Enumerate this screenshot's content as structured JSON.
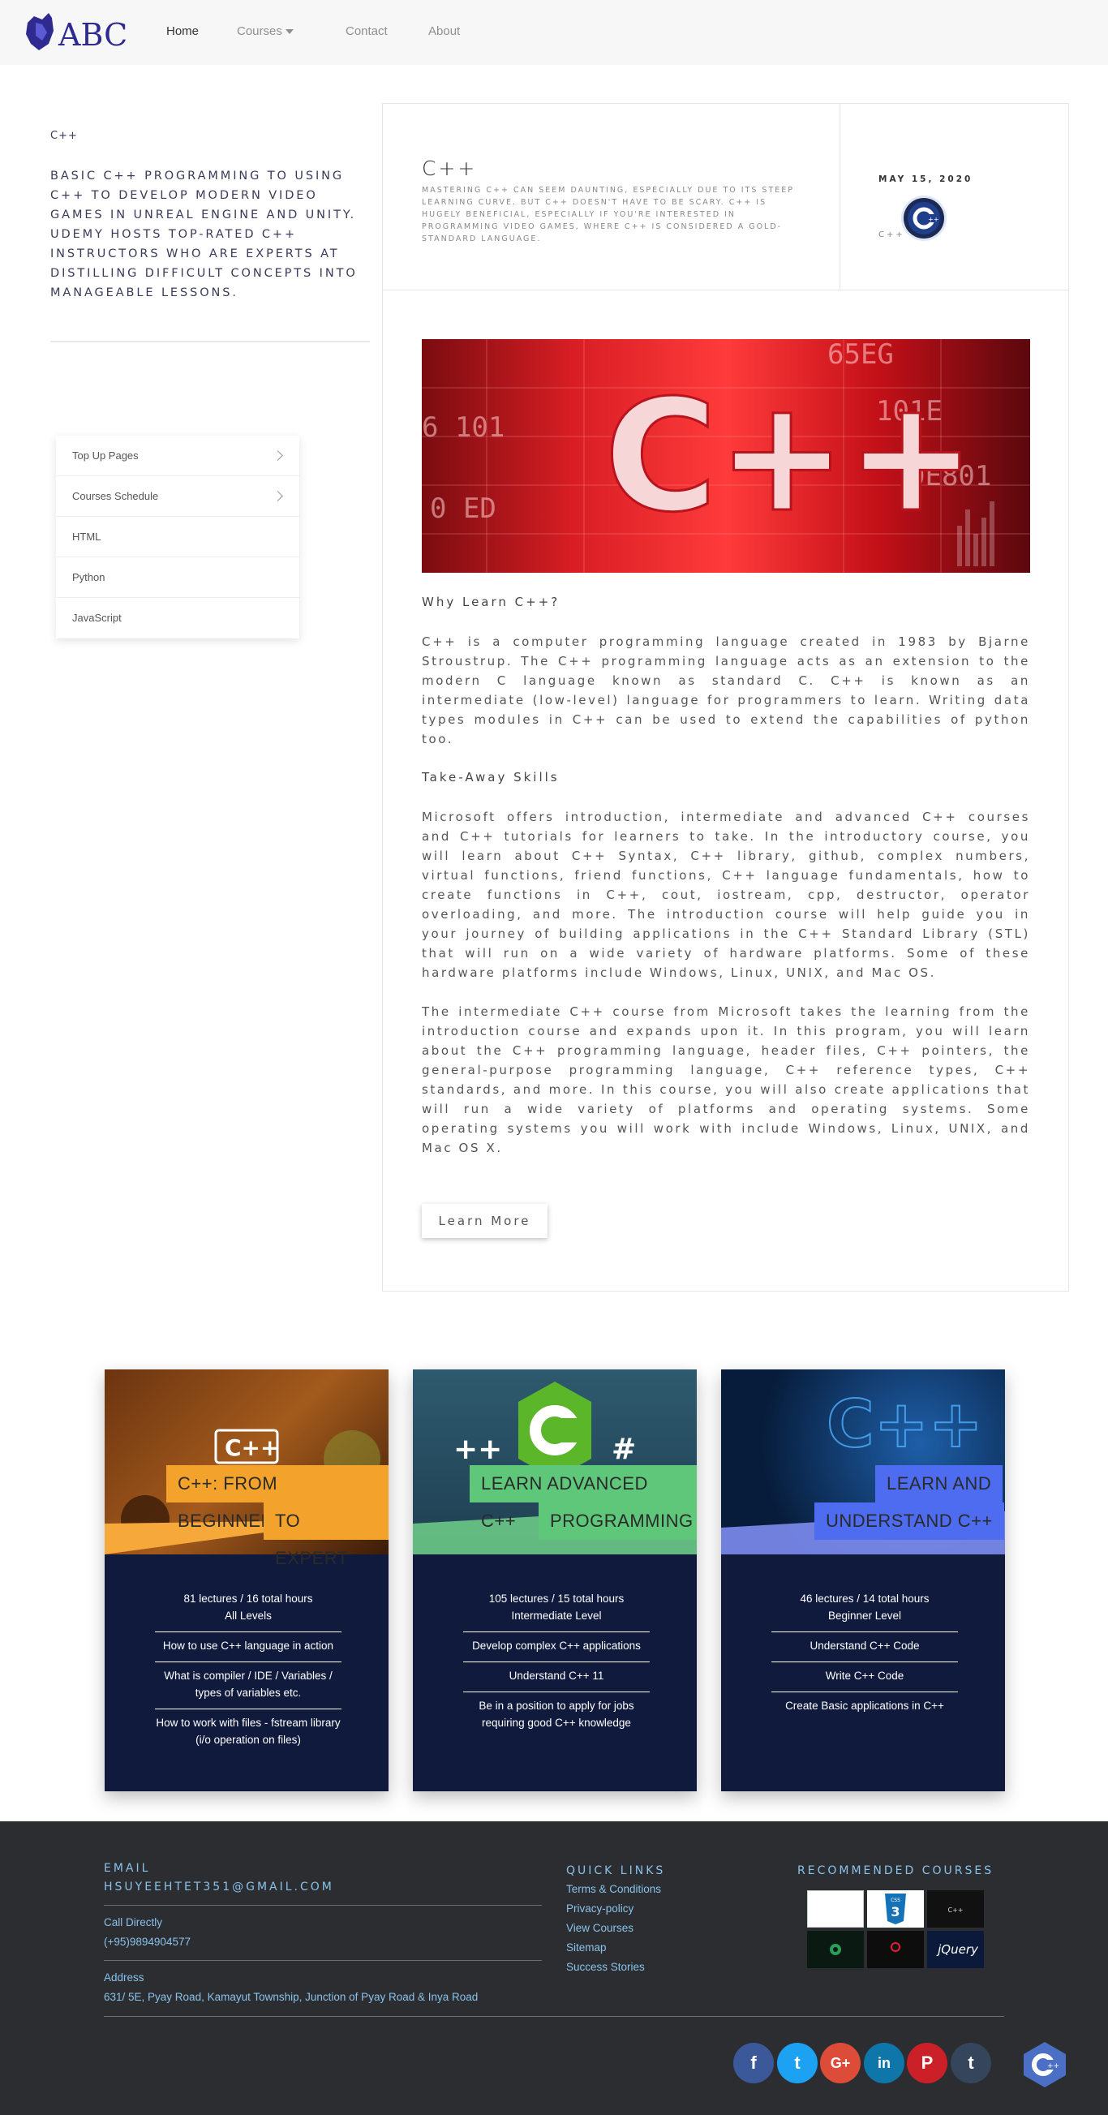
{
  "nav": {
    "brand": "ABC",
    "home": "Home",
    "courses": "Courses",
    "contact": "Contact",
    "about": "About"
  },
  "sidebar": {
    "title": "C++",
    "description": "Basic C++ programming to using C++ to develop modern video games in Unreal Engine and Unity. Udemy hosts top-rated C++ instructors who are experts at distilling difficult concepts into manageable lessons.",
    "menu": [
      "Top Up Pages",
      "Courses Schedule",
      "HTML",
      "Python",
      "JavaScript"
    ]
  },
  "post": {
    "title": "C++",
    "summary": "Mastering C++ can seem daunting, especially due to its steep learning curve. But C++ doesn't have to be scary. C++ is hugely beneficial, especially if you're interested in programming video games, where C++ is considered a gold-standard language.",
    "date": "MAY 15, 2020",
    "category": "C++",
    "hero_text": "C++",
    "heading1": "Why Learn C++?",
    "para1": "C++ is a computer programming language created in 1983 by Bjarne Stroustrup. The C++ programming language acts as an extension to the modern C language known as standard C. C++ is known as an intermediate (low-level) language for programmers to learn. Writing data types modules in C++ can be used to extend the capabilities of python too.",
    "heading2": "Take-Away Skills",
    "para2": "Microsoft offers introduction, intermediate and advanced C++ courses and C++ tutorials for learners to take. In the introductory course, you will learn about C++ Syntax, C++ library, github, complex numbers, virtual functions, friend functions, C++ language fundamentals, how to create functions in C++, cout, iostream, cpp, destructor, operator overloading, and more. The introduction course will help guide you in your journey of building applications in the C++ Standard Library (STL) that will run on a wide variety of hardware platforms. Some of these hardware platforms include Windows, Linux, UNIX, and Mac OS.",
    "para3": "The intermediate C++ course from Microsoft takes the learning from the introduction course and expands upon it. In this program, you will learn about the C++ programming language, header files, C++ pointers, the general-purpose programming language, C++ reference types, C++ standards, and more. In this course, you will also create applications that will run a wide variety of platforms and operating systems. Some operating systems you will work with include Windows, Linux, UNIX, and Mac OS X.",
    "button": "Learn More"
  },
  "cards": [
    {
      "title1": "C++: FROM BEGINNER",
      "title2": "TO EXPERT",
      "stats": "81 lectures   / 16 total hours",
      "level": "All Levels",
      "items": [
        "How to use C++ language in action",
        "What is compiler / IDE / Variables / types of variables etc.",
        "How to work with files - fstream library (i/o operation on files)"
      ],
      "accent": "#f3a22b"
    },
    {
      "title1": "LEARN ADVANCED C++",
      "title2": "PROGRAMMING",
      "stats": "105 lectures   / 15 total hours",
      "level": "Intermediate Level",
      "items": [
        "Develop complex C++ applications",
        "Understand C++ 11",
        "Be in a position to apply for jobs requiring good C++ knowledge"
      ],
      "accent": "#5fc77a"
    },
    {
      "title1": "LEARN AND",
      "title2": "UNDERSTAND C++",
      "stats": "46 lectures   / 14 total hours",
      "level": "Beginner Level",
      "items": [
        "Understand C++ Code",
        "Write C++ Code",
        "Create Basic applications in C++"
      ],
      "accent": "#4d6cf0"
    }
  ],
  "footer": {
    "email_label": "EMAIL",
    "email": "HSUYEEHTET351@GMAIL.COM",
    "call_label": "Call Directly",
    "phone": "(+95)9894904577",
    "address_label": "Address",
    "address": "631/ 5E, Pyay Road, Kamayut Township, Junction of Pyay Road & Inya Road",
    "quick_links_title": "QUICK LINKS",
    "quick_links": [
      "Terms & Conditions",
      "Privacy-policy",
      "View Courses",
      "Sitemap",
      "Success Stories"
    ],
    "recommended_title": "RECOMMENDED COURSES",
    "thumb_css": "CSS",
    "thumb_cpp": "C++",
    "thumb_jquery": "jQuery"
  },
  "social": [
    {
      "icon": "f",
      "name": "facebook",
      "color": "#3b5998"
    },
    {
      "icon": "t",
      "name": "twitter",
      "color": "#1da1f2"
    },
    {
      "icon": "G+",
      "name": "google-plus",
      "color": "#dd4b39"
    },
    {
      "icon": "in",
      "name": "linkedin",
      "color": "#0e76a8"
    },
    {
      "icon": "P",
      "name": "pinterest",
      "color": "#cb2027"
    },
    {
      "icon": "t",
      "name": "tumblr",
      "color": "#35465c"
    }
  ]
}
